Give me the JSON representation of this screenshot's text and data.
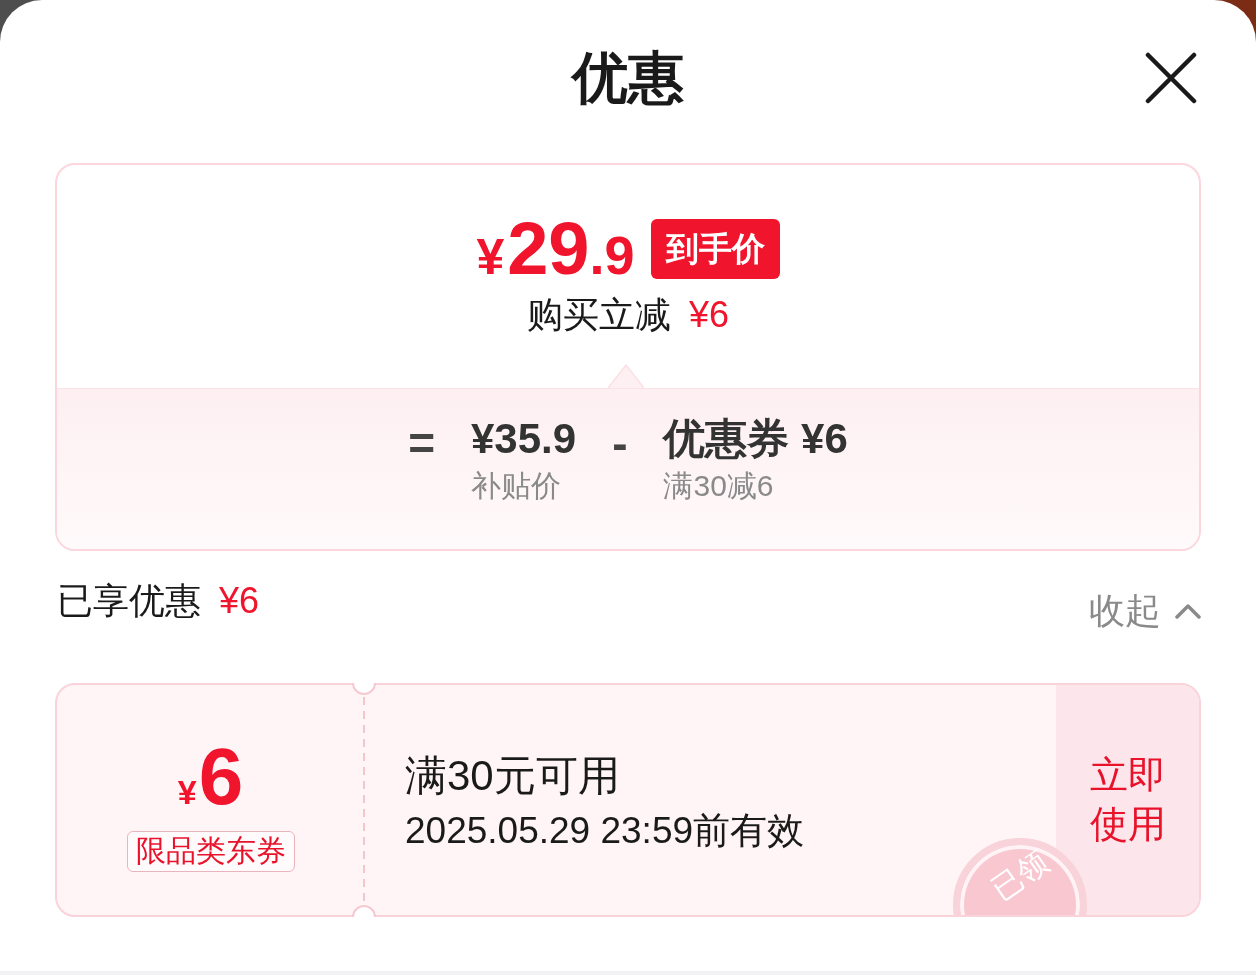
{
  "header": {
    "title": "优惠"
  },
  "summary": {
    "price": {
      "currency": "¥",
      "integer": "29",
      "fraction": ".9"
    },
    "badge": "到手价",
    "reduction": {
      "label": "购买立减",
      "amount": "¥6"
    },
    "breakdown": {
      "equals": "=",
      "minus": "-",
      "terms": [
        {
          "amount": "¥35.9",
          "label": "补贴价"
        },
        {
          "amount": "优惠券 ¥6",
          "label": "满30减6"
        }
      ]
    }
  },
  "savings": {
    "label": "已享优惠",
    "amount": "¥6",
    "toggle": {
      "label": "收起",
      "expanded": true
    }
  },
  "coupons": [
    {
      "currency": "¥",
      "value": "6",
      "tag": "限品类东券",
      "condition": "满30元可用",
      "validity": "2025.05.29 23:59前有效",
      "action": "立即使用",
      "stamp": "已领"
    }
  ]
}
